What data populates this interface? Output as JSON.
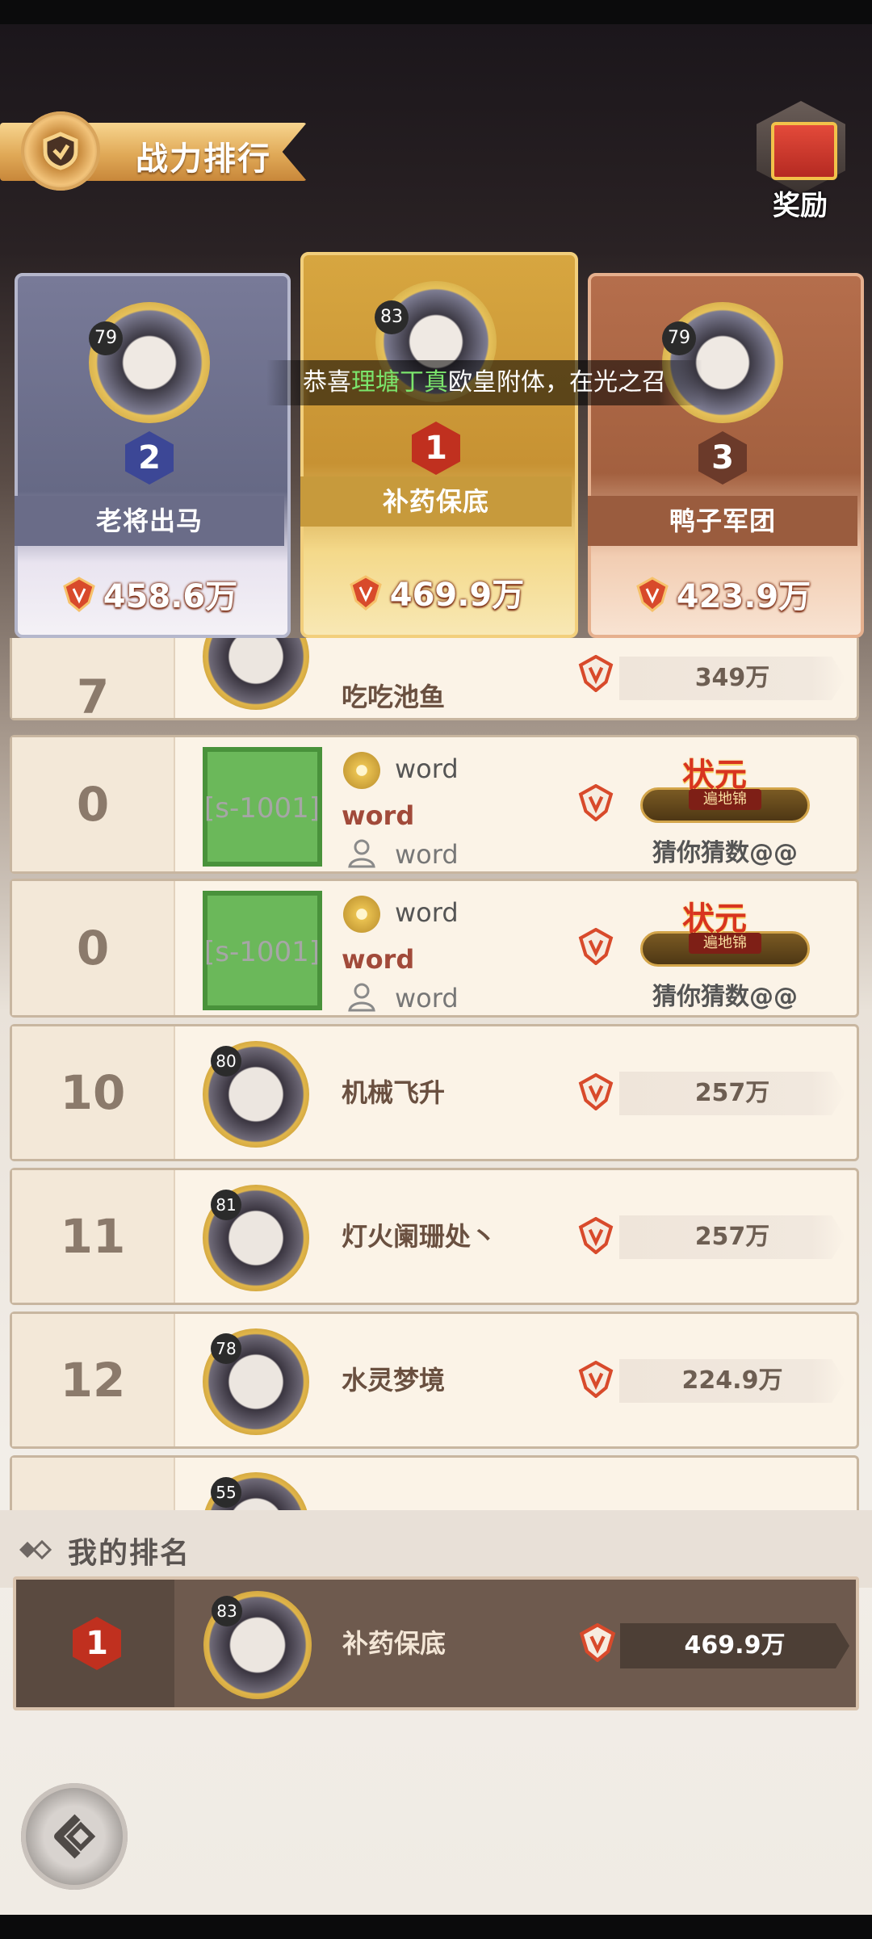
{
  "header": {
    "title": "战力排行",
    "reward_label": "奖励"
  },
  "podium": [
    {
      "rank": "2",
      "level": "79",
      "name": "老将出马",
      "power": "458.6万"
    },
    {
      "rank": "1",
      "level": "83",
      "name": "补药保底",
      "power": "469.9万"
    },
    {
      "rank": "3",
      "level": "79",
      "name": "鸭子军团",
      "power": "423.9万"
    }
  ],
  "announcement": {
    "prefix": "恭喜",
    "player": "理塘丁真",
    "suffix": "欧皇附体，在光之召"
  },
  "list": {
    "rows": [
      {
        "rank": "7",
        "name": "吃吃池鱼",
        "power": "349万",
        "level": ""
      },
      {
        "rank": "0",
        "placeholder": "[s-1001]",
        "line1": "word",
        "line2": "word",
        "line3": "word",
        "title_big": "状元",
        "title_sub": "遍地锦",
        "guess": "猜你猜数@@"
      },
      {
        "rank": "0",
        "placeholder": "[s-1001]",
        "line1": "word",
        "line2": "word",
        "line3": "word",
        "title_big": "状元",
        "title_sub": "遍地锦",
        "guess": "猜你猜数@@"
      },
      {
        "rank": "10",
        "level": "80",
        "name": "机械飞升",
        "power": "257万"
      },
      {
        "rank": "11",
        "level": "81",
        "name": "灯火阑珊处丶",
        "power": "257万"
      },
      {
        "rank": "12",
        "level": "78",
        "name": "水灵梦境",
        "power": "224.9万"
      },
      {
        "level": "55"
      }
    ]
  },
  "my_rank": {
    "section_title": "我的排名",
    "rank": "1",
    "level": "83",
    "name": "补药保底",
    "power": "469.9万"
  },
  "colors": {
    "highlight_name": "#7be56c",
    "rank1_badge": "#c0301f",
    "rank2_badge": "#3c4796",
    "rank3_badge": "#6b3a2a"
  }
}
